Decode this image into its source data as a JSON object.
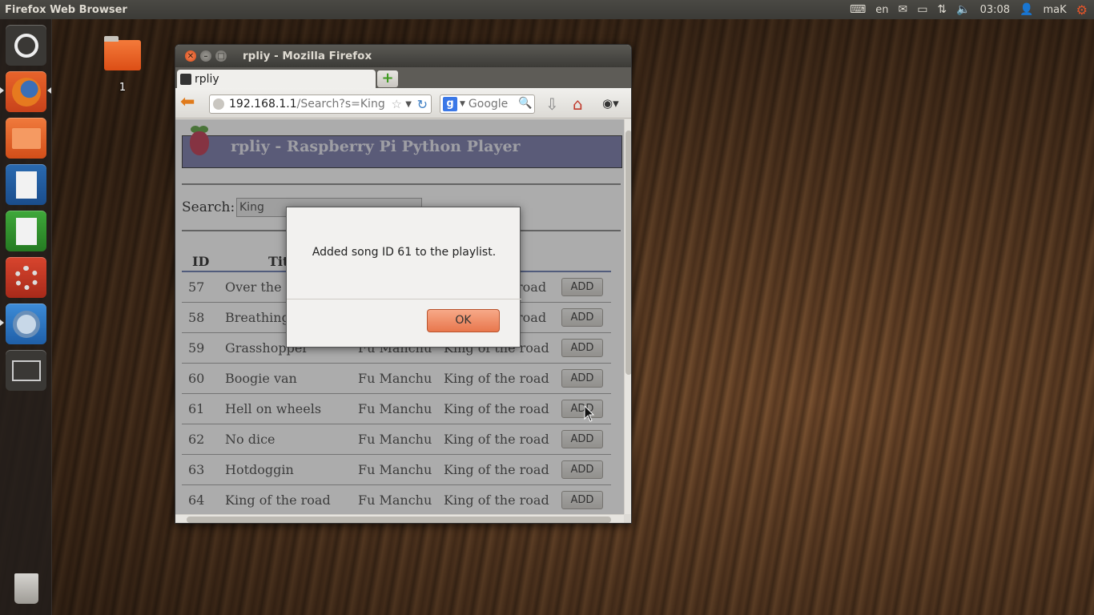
{
  "top_panel": {
    "app_name": "Firefox Web Browser",
    "keyboard_layout": "en",
    "clock": "03:08",
    "user": "maK"
  },
  "desktop": {
    "folder_label": "1"
  },
  "launcher": {
    "items": [
      "ubuntu-dash-icon",
      "firefox-icon",
      "files-icon",
      "writer-icon",
      "calc-icon",
      "settings-icon",
      "chromium-icon",
      "workspace-switcher-icon",
      "trash-icon"
    ]
  },
  "window": {
    "title": "rpliy - Mozilla Firefox",
    "tab_label": "rpliy",
    "url_host": "192.168.1.1",
    "url_path": "/Search?s=King",
    "search_placeholder": "Google"
  },
  "page": {
    "heading": "rpliy - Raspberry Pi Python Player",
    "search_label": "Search:",
    "search_value": "King",
    "columns": [
      "ID",
      "Title"
    ],
    "add_label": "ADD",
    "rows": [
      {
        "id": "57",
        "title": "Over the",
        "artist": "",
        "album": "road"
      },
      {
        "id": "58",
        "title": "Breathing",
        "artist": "",
        "album": "road"
      },
      {
        "id": "59",
        "title": "Grasshopper",
        "artist": "Fu Manchu",
        "album": "King of the road"
      },
      {
        "id": "60",
        "title": "Boogie van",
        "artist": "Fu Manchu",
        "album": "King of the road"
      },
      {
        "id": "61",
        "title": "Hell on wheels",
        "artist": "Fu Manchu",
        "album": "King of the road"
      },
      {
        "id": "62",
        "title": "No dice",
        "artist": "Fu Manchu",
        "album": "King of the road"
      },
      {
        "id": "63",
        "title": "Hotdoggin",
        "artist": "Fu Manchu",
        "album": "King of the road"
      },
      {
        "id": "64",
        "title": "King of the road",
        "artist": "Fu Manchu",
        "album": "King of the road"
      }
    ]
  },
  "dialog": {
    "message": "Added song ID 61 to the playlist.",
    "ok_label": "OK"
  }
}
